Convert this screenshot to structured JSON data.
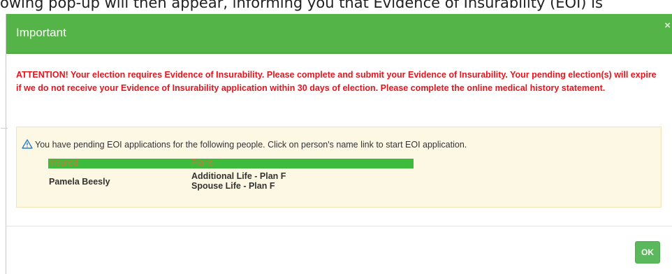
{
  "background": {
    "caption": "owing pop-up will then appear, informing you that Evidence of Insurability (EOI) is"
  },
  "modal": {
    "title": "Important",
    "close_glyph": "×",
    "attention": "ATTENTION! Your election requires Evidence of Insurability. Please complete and submit your Evidence of Insurability. Your pending election(s) will expire if we do not receive your Evidence of Insurability application within 30 days of election. Please complete the online medical history statement.",
    "notice": {
      "icon": "warning-triangle-icon",
      "text": "You have pending EOI applications for the following people. Click on person's name link to start EOI application.",
      "columns": [
        "Insured",
        "Plans"
      ],
      "rows": [
        {
          "insured": "Pamela Beesly",
          "plans": [
            "Additional Life - Plan F",
            "Spouse Life - Plan F"
          ]
        }
      ]
    },
    "ok_label": "OK"
  },
  "colors": {
    "header_green": "#54b447",
    "attention_red": "#e8141c",
    "notice_bg": "#fcf8e3",
    "table_header_green": "#3dbb3d",
    "table_header_text": "#b8823a",
    "ok_green": "#5cb85c"
  }
}
